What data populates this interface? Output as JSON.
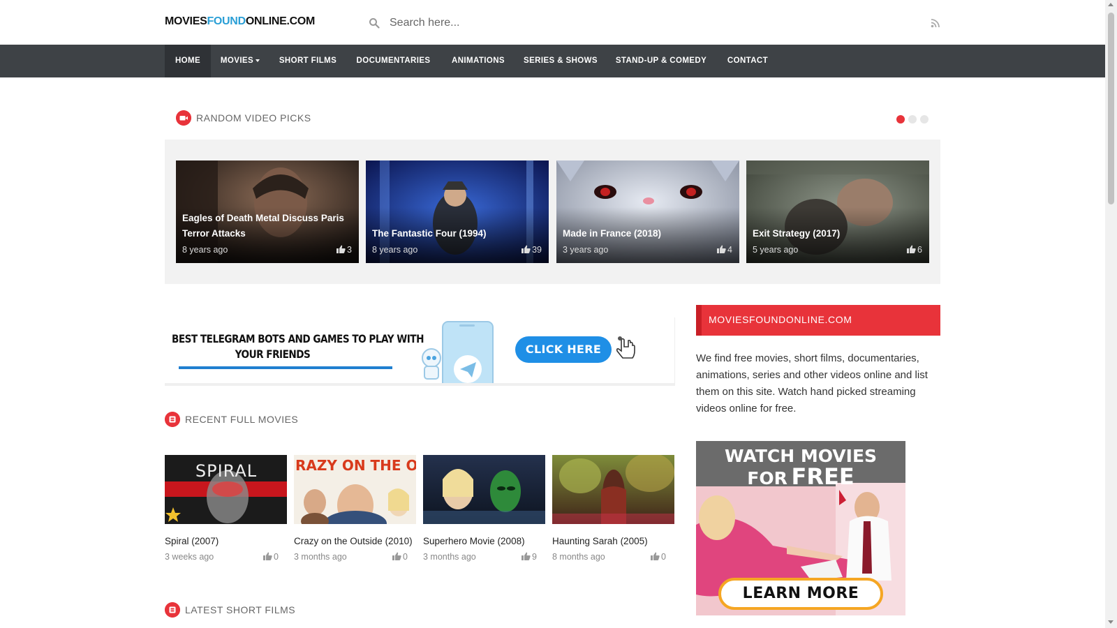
{
  "site": {
    "logo_part1": "MOVIES",
    "logo_part2": "FOUND",
    "logo_part3": "ONLINE.COM",
    "accent_color": "#2a9fd6",
    "brand_red": "#e8333a"
  },
  "search": {
    "placeholder": "Search here...",
    "value": "",
    "icon": "search-icon"
  },
  "header": {
    "rss_icon": "rss-icon"
  },
  "nav": {
    "items": [
      {
        "label": "HOME",
        "active": true
      },
      {
        "label": "MOVIES",
        "dropdown": true
      },
      {
        "label": "SHORT FILMS"
      },
      {
        "label": "DOCUMENTARIES"
      },
      {
        "label": "ANIMATIONS"
      },
      {
        "label": "SERIES & SHOWS"
      },
      {
        "label": "STAND-UP & COMEDY"
      },
      {
        "label": "CONTACT"
      }
    ]
  },
  "random_picks": {
    "title": "RANDOM VIDEO PICKS",
    "icon": "video-camera-icon",
    "carousel_page": 1,
    "carousel_pages": 3,
    "items": [
      {
        "title": "Eagles of Death Metal Discuss Paris Terror Attacks",
        "date": "8 years ago",
        "likes": "3"
      },
      {
        "title": "The Fantastic Four (1994)",
        "date": "8 years ago",
        "likes": "39"
      },
      {
        "title": "Made in France (2018)",
        "date": "3 years ago",
        "likes": "4"
      },
      {
        "title": "Exit Strategy (2017)",
        "date": "5 years ago",
        "likes": "6"
      }
    ]
  },
  "banner": {
    "title_line1": "BEST TELEGRAM BOTS AND GAMES TO PLAY WITH",
    "title_line2": "YOUR FRIENDS",
    "button": "CLICK HERE"
  },
  "recent_movies": {
    "title": "RECENT FULL MOVIES",
    "icon": "film-icon",
    "items": [
      {
        "title": "Spiral (2007)",
        "date": "3 weeks ago",
        "likes": "0",
        "poster_text": "SPIRAL"
      },
      {
        "title": "Crazy on the Outside (2010)",
        "date": "3 months ago",
        "likes": "0",
        "poster_text": "RAZY ON THE OUTSID"
      },
      {
        "title": "Superhero Movie (2008)",
        "date": "3 months ago",
        "likes": "9"
      },
      {
        "title": "Haunting Sarah (2005)",
        "date": "8 months ago",
        "likes": "0"
      }
    ]
  },
  "latest_shorts": {
    "title": "LATEST SHORT FILMS",
    "icon": "film-icon"
  },
  "sidebar": {
    "heading": "MOVIESFOUNDONLINE.COM",
    "text": "We find free movies, short films, documentaries, animations, series and other videos online and list them on this site. Watch hand picked streaming videos online for free.",
    "ad": {
      "line1": "WATCH MOVIES",
      "line2_small": "FOR",
      "line2_big": "FREE",
      "button": "LEARN MORE"
    }
  }
}
